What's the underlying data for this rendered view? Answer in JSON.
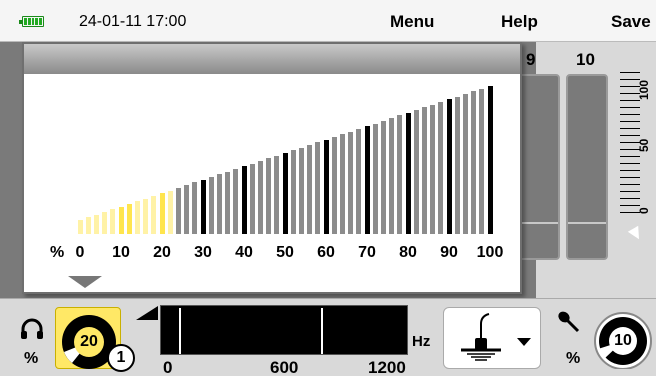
{
  "topbar": {
    "datetime": "24-01-11 17:00",
    "menu_label": "Menu",
    "help_label": "Help",
    "save_label": "Save"
  },
  "channels": {
    "labels": [
      "9",
      "10"
    ]
  },
  "side_scale": {
    "labels": [
      "100",
      "50",
      "0"
    ]
  },
  "popup": {
    "unit": "%",
    "axis_labels": [
      "0",
      "10",
      "20",
      "30",
      "40",
      "50",
      "60",
      "70",
      "80",
      "90",
      "100"
    ],
    "level_percent": 22,
    "colors": {
      "active": "#ffe54d",
      "active_light": "#fff2a6",
      "inactive": "#8c8c8c",
      "major": "#000000"
    }
  },
  "bottom": {
    "left_unit": "%",
    "left_value": "20",
    "marker_number": "1",
    "freq_unit": "Hz",
    "freq_labels": [
      "0",
      "600",
      "1200"
    ],
    "right_unit": "%",
    "right_value": "10",
    "icons": {
      "headphones": "headphones-icon",
      "microphone": "microphone-icon",
      "mic_source": "microphone-stand-icon"
    }
  }
}
